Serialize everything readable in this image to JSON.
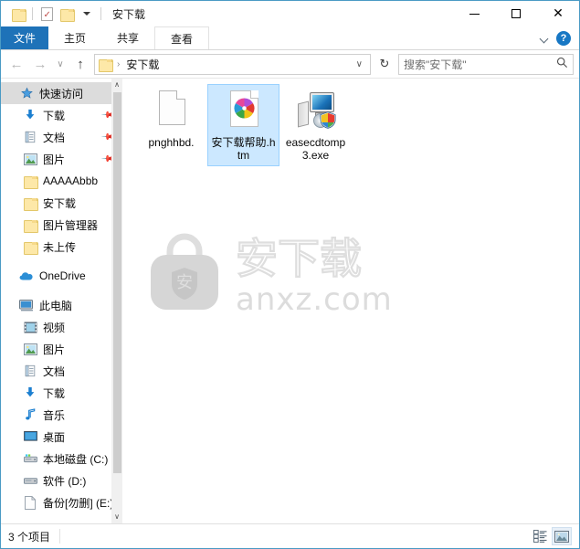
{
  "window": {
    "title": "安下载",
    "quick_access": [
      {
        "name": "folder-icon",
        "label": "属性"
      },
      {
        "name": "properties-icon",
        "label": "属性"
      },
      {
        "name": "new-folder-icon",
        "label": "新建文件夹"
      },
      {
        "name": "customize-dropdown-icon",
        "label": "自定义快速访问工具栏"
      }
    ],
    "controls": {
      "minimize": "—",
      "maximize": "□",
      "close": "✕"
    }
  },
  "ribbon": {
    "tabs": [
      {
        "label": "文件",
        "state": "file"
      },
      {
        "label": "主页",
        "state": "normal"
      },
      {
        "label": "共享",
        "state": "normal"
      },
      {
        "label": "查看",
        "state": "hover"
      }
    ],
    "collapse_label": "∨",
    "help_label": "?"
  },
  "address": {
    "back": "←",
    "forward": "→",
    "recent": "∨",
    "up": "↑",
    "crumb": "安下载",
    "crumb_sep": "›",
    "crumb_dropdown": "∨",
    "refresh": "↻"
  },
  "search": {
    "placeholder": "搜索\"安下载\"",
    "icon": "⚲"
  },
  "sidebar": {
    "groups": [
      {
        "header": {
          "label": "快速访问",
          "icon": "star-pin-icon",
          "selected": true
        },
        "items": [
          {
            "label": "下载",
            "icon": "download-icon",
            "pinned": true
          },
          {
            "label": "文档",
            "icon": "documents-icon",
            "pinned": true
          },
          {
            "label": "图片",
            "icon": "pictures-icon",
            "pinned": true
          },
          {
            "label": "AAAAAbbb",
            "icon": "folder-icon",
            "pinned": false
          },
          {
            "label": "安下载",
            "icon": "folder-icon",
            "pinned": false
          },
          {
            "label": "图片管理器",
            "icon": "folder-icon",
            "pinned": false
          },
          {
            "label": "未上传",
            "icon": "folder-icon",
            "pinned": false
          }
        ]
      },
      {
        "header": {
          "label": "OneDrive",
          "icon": "onedrive-icon",
          "selected": false
        },
        "items": []
      },
      {
        "header": {
          "label": "此电脑",
          "icon": "this-pc-icon",
          "selected": false
        },
        "items": [
          {
            "label": "视频",
            "icon": "videos-icon",
            "pinned": false
          },
          {
            "label": "图片",
            "icon": "pictures-icon",
            "pinned": false
          },
          {
            "label": "文档",
            "icon": "documents-icon",
            "pinned": false
          },
          {
            "label": "下载",
            "icon": "download-icon",
            "pinned": false
          },
          {
            "label": "音乐",
            "icon": "music-icon",
            "pinned": false
          },
          {
            "label": "桌面",
            "icon": "desktop-icon",
            "pinned": false
          },
          {
            "label": "本地磁盘 (C:)",
            "icon": "system-drive-icon",
            "pinned": false
          },
          {
            "label": "软件 (D:)",
            "icon": "drive-icon",
            "pinned": false
          },
          {
            "label": "备份[勿删] (E:)",
            "icon": "drive-blank-icon",
            "pinned": false
          }
        ]
      }
    ],
    "scroll_up": "∧",
    "scroll_down": "∨"
  },
  "files": [
    {
      "label": "pnghhbd.",
      "icon": "generic-file-icon",
      "selected": false
    },
    {
      "label": "安下载帮助.htm",
      "icon": "html-file-icon",
      "selected": true
    },
    {
      "label": "easecdtomp3.exe",
      "icon": "executable-file-icon",
      "selected": false
    }
  ],
  "watermark": {
    "shield_char": "安",
    "brand_cn": "安下载",
    "brand_domain": "anxz.com"
  },
  "status": {
    "item_count": "3 个项目",
    "views": [
      {
        "name": "details-view-button",
        "active": false
      },
      {
        "name": "large-icons-view-button",
        "active": true
      }
    ]
  },
  "colors": {
    "accent": "#1e72b8",
    "selection": "#cce8ff",
    "window_border": "#4a9ac4",
    "folder": "#fde8a8"
  }
}
